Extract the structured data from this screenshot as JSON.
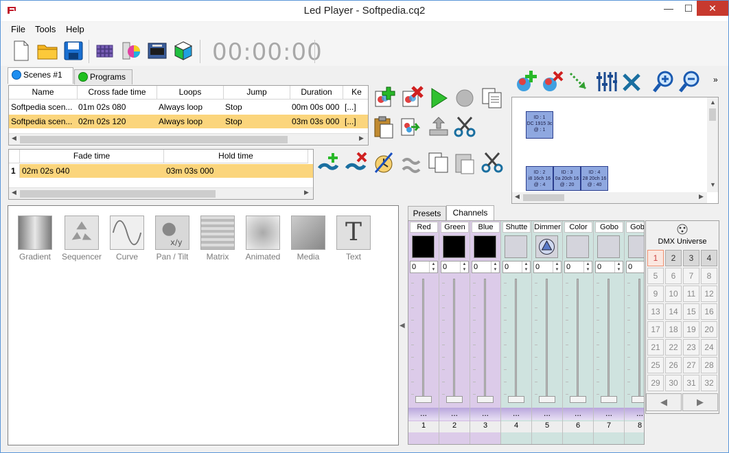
{
  "window": {
    "title": "Led Player - Softpedia.cq2",
    "minimize": "—",
    "maximize": "☐",
    "close": "✕"
  },
  "menu": [
    "File",
    "Tools",
    "Help"
  ],
  "toolbar": {
    "timer": "00:00:00"
  },
  "scene_tabs": [
    {
      "label": "Scenes #1",
      "color": "#1e8ef0"
    },
    {
      "label": "Programs",
      "color": "#20c020"
    }
  ],
  "scenes_table": {
    "headers": [
      "Name",
      "Cross fade time",
      "Loops",
      "Jump",
      "Duration",
      "Ke"
    ],
    "rows": [
      [
        "Softpedia scen...",
        "01m 02s 080",
        "Always loop",
        "Stop",
        "00m 00s 000",
        "[...]"
      ],
      [
        "Softpedia scen...",
        "02m 02s 120",
        "Always loop",
        "Stop",
        "03m 03s 000",
        "[...]"
      ]
    ]
  },
  "steps_table": {
    "headers": [
      "Fade time",
      "Hold time"
    ],
    "rows": [
      [
        "1",
        "02m 02s 040",
        "03m 03s 000"
      ]
    ]
  },
  "fixtures": [
    {
      "lines": [
        "ID : 1",
        "DC 1915 3c",
        "@ : 1"
      ]
    },
    {
      "lines": [
        "ID : 2",
        "i8 16ch 16",
        "@ : 4"
      ]
    },
    {
      "lines": [
        "ID : 3",
        "0a 20ch 16",
        "@ : 20"
      ]
    },
    {
      "lines": [
        "ID : 4",
        "28 20ch 16",
        "@ : 40"
      ]
    }
  ],
  "effects": [
    "Gradient",
    "Sequencer",
    "Curve",
    "Pan / Tilt",
    "Matrix",
    "Animated",
    "Media",
    "Text"
  ],
  "channel_tabs": [
    "Presets",
    "Channels"
  ],
  "channels": [
    {
      "name": "Red",
      "value": "0",
      "num": "1",
      "dots": "...",
      "swatch": "#000000",
      "bg": "#dccbe9"
    },
    {
      "name": "Green",
      "value": "0",
      "num": "2",
      "dots": "...",
      "swatch": "#000000",
      "bg": "#dccbe9"
    },
    {
      "name": "Blue",
      "value": "0",
      "num": "3",
      "dots": "...",
      "swatch": "#000000",
      "bg": "#dccbe9"
    },
    {
      "name": "Shutte",
      "value": "0",
      "num": "4",
      "dots": "...",
      "swatch": "#d4d4dc",
      "bg": "#cfe3df"
    },
    {
      "name": "Dimmer",
      "value": "0",
      "num": "5",
      "dots": "...",
      "swatch": "#d4d4dc",
      "bg": "#cfe3df"
    },
    {
      "name": "Color",
      "value": "0",
      "num": "6",
      "dots": "...",
      "swatch": "#d4d4dc",
      "bg": "#cfe3df"
    },
    {
      "name": "Gobo",
      "value": "0",
      "num": "7",
      "dots": "...",
      "swatch": "#d4d4dc",
      "bg": "#cfe3df"
    },
    {
      "name": "GobR",
      "value": "0",
      "num": "8",
      "dots": "...",
      "swatch": "#d4d4dc",
      "bg": "#cfe3df"
    }
  ],
  "dmx": {
    "label": "DMX Universe",
    "buttons": [
      "1",
      "2",
      "3",
      "4",
      "5",
      "6",
      "7",
      "8",
      "9",
      "10",
      "11",
      "12",
      "13",
      "14",
      "15",
      "16",
      "17",
      "18",
      "19",
      "20",
      "21",
      "22",
      "23",
      "24",
      "25",
      "26",
      "27",
      "28",
      "29",
      "30",
      "31",
      "32"
    ],
    "prev": "◀",
    "next": "▶"
  }
}
